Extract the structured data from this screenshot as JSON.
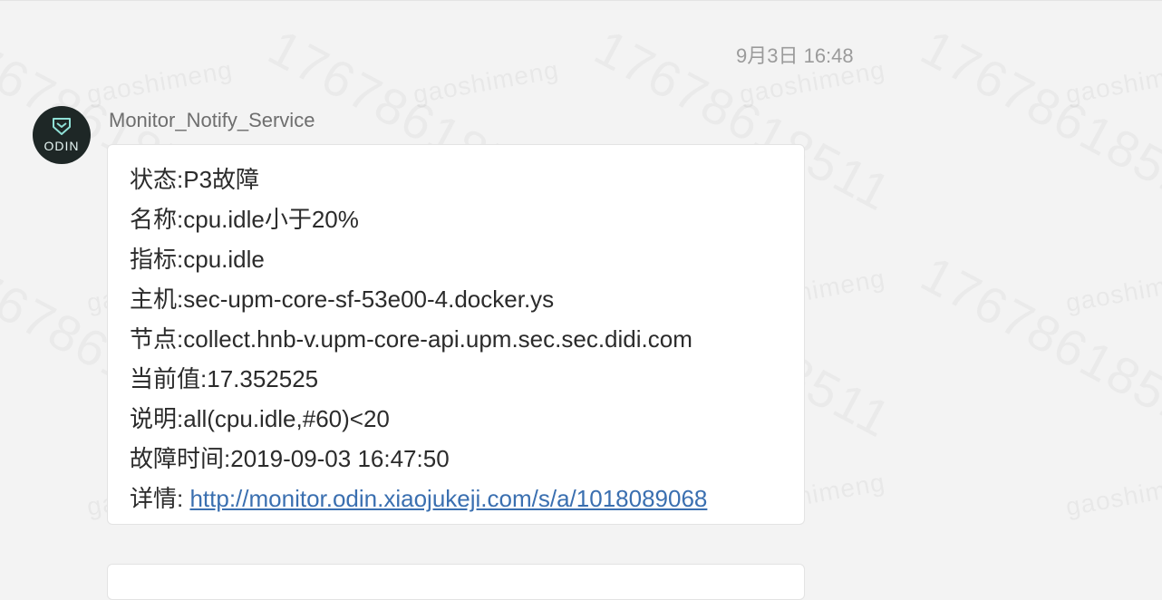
{
  "watermark": {
    "name": "gaoshimeng",
    "number": "17678618511"
  },
  "message": {
    "timestamp": "9月3日 16:48",
    "sender": "Monitor_Notify_Service",
    "avatar": {
      "icon": "odin-logo-icon",
      "text": "ODIN"
    },
    "lines": [
      {
        "label": "状态:",
        "value": "P3故障"
      },
      {
        "label": "名称:",
        "value": "cpu.idle小于20%"
      },
      {
        "label": "指标:",
        "value": "cpu.idle"
      },
      {
        "label": "主机:",
        "value": "sec-upm-core-sf-53e00-4.docker.ys"
      },
      {
        "label": "节点:",
        "value": "collect.hnb-v.upm-core-api.upm.sec.sec.didi.com"
      },
      {
        "label": "当前值:",
        "value": "17.352525"
      },
      {
        "label": "说明:",
        "value": "all(cpu.idle,#60)<20"
      },
      {
        "label": "故障时间:",
        "value": "2019-09-03 16:47:50"
      }
    ],
    "details": {
      "label": "详情: ",
      "url": "http://monitor.odin.xiaojukeji.com/s/a/1018089068"
    }
  }
}
